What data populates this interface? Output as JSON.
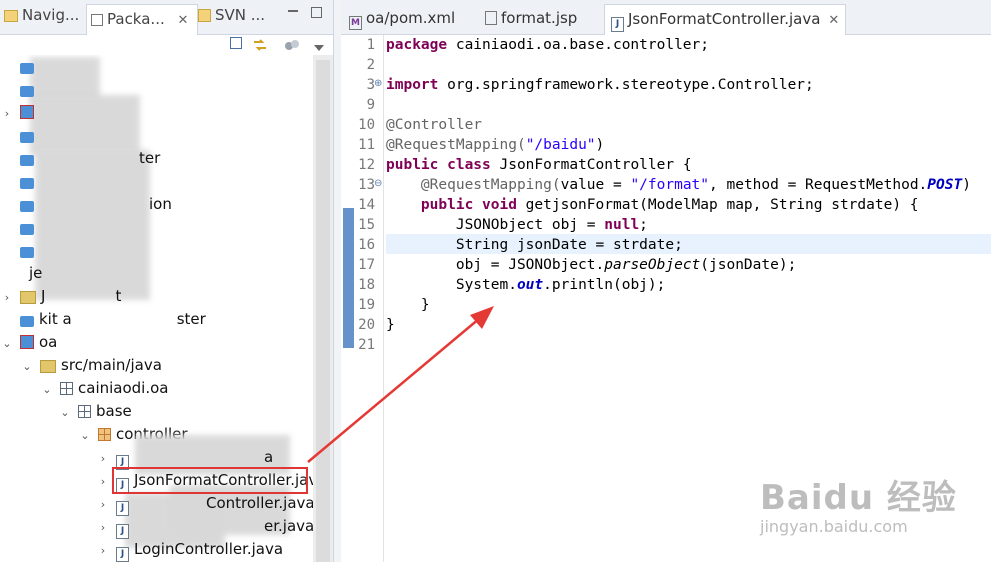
{
  "left_panel": {
    "tabs": [
      {
        "label": "Navig..."
      },
      {
        "label": "Packa..."
      },
      {
        "label": "SVN ..."
      }
    ],
    "close_glyph": "✕",
    "tree": [
      {
        "label": "ter"
      },
      {
        "label": "ion"
      },
      {
        "label": "je"
      },
      {
        "label": "J"
      },
      {
        "label": "t"
      },
      {
        "label": "kit a"
      },
      {
        "label": "ster"
      },
      {
        "label": "oa"
      },
      {
        "label": "src/main/java"
      },
      {
        "label": "cainiaodi.oa"
      },
      {
        "label": "base"
      },
      {
        "label": "controller"
      },
      {
        "label": "a"
      },
      {
        "label": "JsonFormatController.java"
      },
      {
        "label": "Controller.java"
      },
      {
        "label": "er.java"
      },
      {
        "label": "LoginController.java"
      }
    ]
  },
  "editor": {
    "tabs": [
      {
        "label": "oa/pom.xml"
      },
      {
        "label": "format.jsp"
      },
      {
        "label": "JsonFormatController.java"
      }
    ],
    "close_glyph": "✕",
    "line_numbers": [
      "1",
      "2",
      "3",
      "9",
      "10",
      "11",
      "12",
      "13",
      "14",
      "15",
      "16",
      "17",
      "18",
      "19",
      "20",
      "21"
    ],
    "code": {
      "l1_kw": "package",
      "l1_rest": " cainiaodi.oa.base.controller;",
      "l3_kw": "import",
      "l3_rest": " org.springframework.stereotype.Controller;",
      "l10": "@Controller",
      "l11_ann": "@RequestMapping(",
      "l11_str": "\"/baidu\"",
      "l11_end": ")",
      "l12_kw": "public class",
      "l12_rest": " JsonFormatController {",
      "l13_ann": "    @RequestMapping(",
      "l13_a": "value = ",
      "l13_str": "\"/format\"",
      "l13_b": ", method = RequestMethod.",
      "l13_post": "POST",
      "l13_end": ")",
      "l14_kw": "    public void",
      "l14_rest": " getjsonFormat(ModelMap map, String strdate) {",
      "l15_a": "        JSONObject obj = ",
      "l15_kw": "null",
      "l15_end": ";",
      "l16": "        String jsonDate = strdate;",
      "l17_a": "        obj = JSONObject.",
      "l17_it": "parseObject",
      "l17_end": "(jsonDate);",
      "l18_a": "        System.",
      "l18_out": "out",
      "l18_end": ".println(obj);",
      "l19": "    }",
      "l20": "}"
    }
  },
  "watermark": {
    "logo": "Baidu 经验",
    "url": "jingyan.baidu.com"
  },
  "colors": {
    "keyword": "#7f0055",
    "string": "#2a00ff",
    "annotation": "#646464",
    "static_field": "#0000c0",
    "highlight_box": "#e03535",
    "arrow": "#e53935"
  }
}
